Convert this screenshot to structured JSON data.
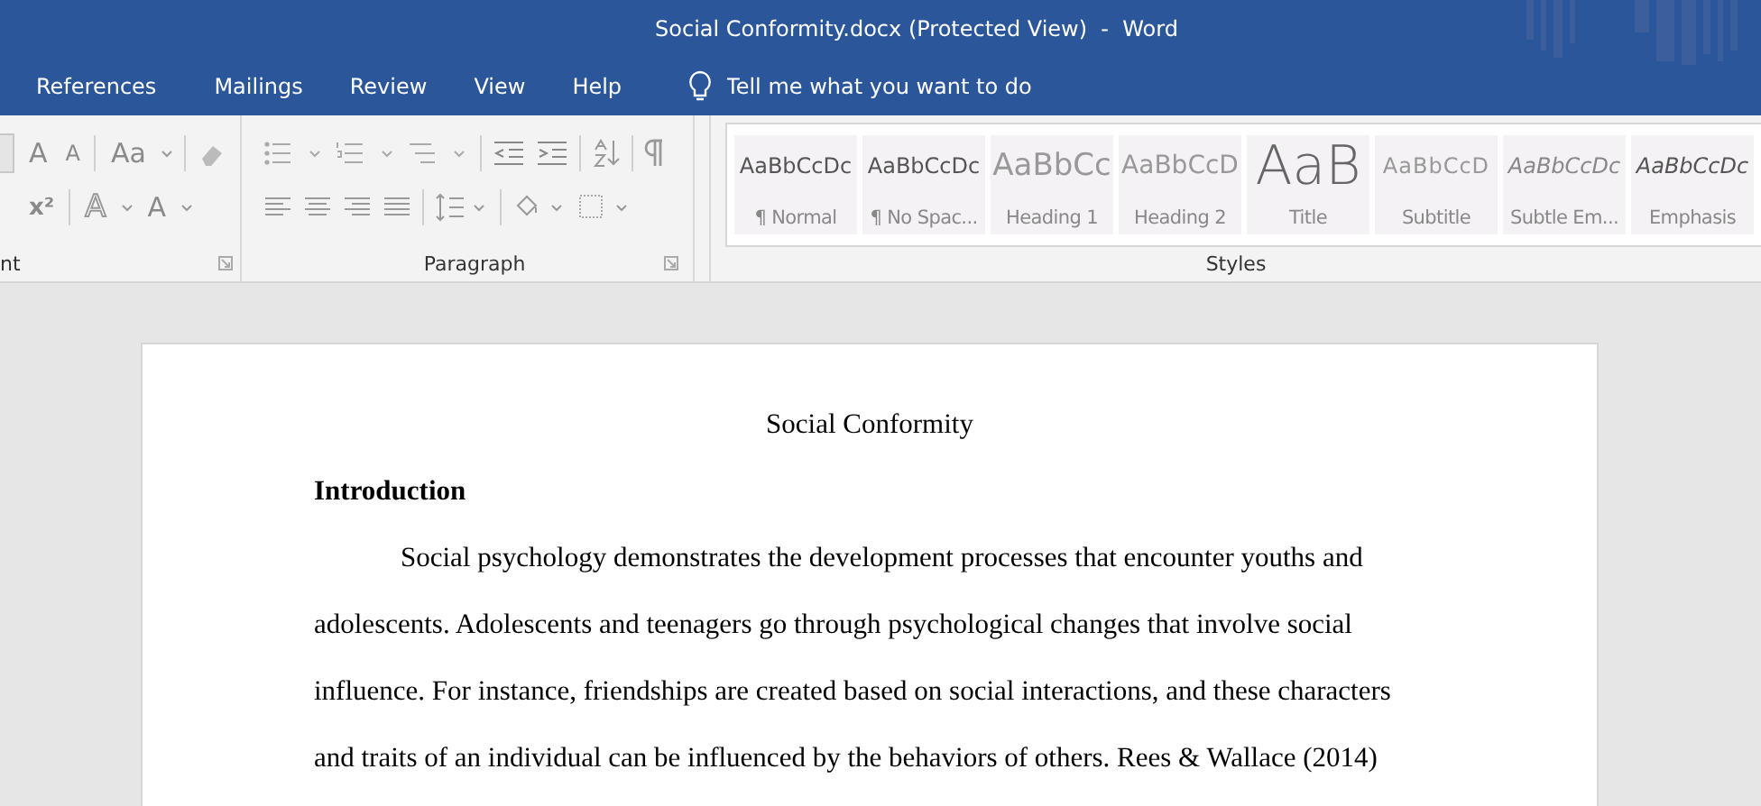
{
  "window": {
    "title": "Social Conformity.docx (Protected View)  -  Word"
  },
  "tabs": [
    {
      "label": "References"
    },
    {
      "label": "Mailings"
    },
    {
      "label": "Review"
    },
    {
      "label": "View"
    },
    {
      "label": "Help"
    }
  ],
  "tell_me": {
    "placeholder": "Tell me what you want to do"
  },
  "ribbon": {
    "font_group": {
      "label": "nt",
      "row1": [
        "A",
        "A",
        "Aa"
      ],
      "row2": [
        "x²",
        "A",
        "A"
      ]
    },
    "paragraph_group": {
      "label": "Paragraph"
    },
    "styles_group": {
      "label": "Styles",
      "styles": [
        {
          "kind": "normal",
          "sample": "AaBbCcDc",
          "name": "¶ Normal"
        },
        {
          "kind": "nospacing",
          "sample": "AaBbCcDc",
          "name": "¶ No Spac..."
        },
        {
          "kind": "heading1",
          "sample": "AaBbCc",
          "name": "Heading 1"
        },
        {
          "kind": "heading2",
          "sample": "AaBbCcD",
          "name": "Heading 2"
        },
        {
          "kind": "title",
          "sample": "AaB",
          "name": "Title"
        },
        {
          "kind": "subtitle",
          "sample": "AaBbCcD",
          "name": "Subtitle"
        },
        {
          "kind": "subtle-emphasis",
          "sample": "AaBbCcDc",
          "name": "Subtle Em..."
        },
        {
          "kind": "emphasis",
          "sample": "AaBbCcDc",
          "name": "Emphasis"
        }
      ]
    }
  },
  "document": {
    "title": "Social Conformity",
    "heading": "Introduction",
    "paragraphs": [
      "Social psychology demonstrates the development processes that encounter youths and adolescents. Adolescents and teenagers go through psychological changes that involve social influence. For instance, friendships are created based on social interactions, and these characters and traits of an individual can be influenced by the behaviors of others. Rees & Wallace (2014)"
    ]
  }
}
